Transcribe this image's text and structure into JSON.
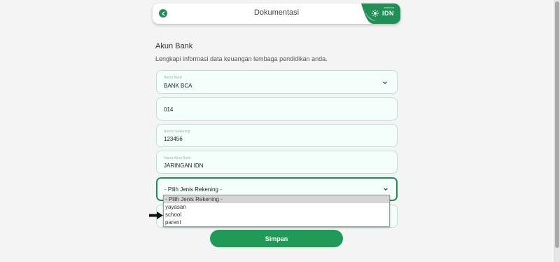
{
  "header": {
    "title": "Dokumentasi",
    "brand_text": "IDN",
    "brand_small": "JARINGAN",
    "brand_color": "#1f8f55"
  },
  "section": {
    "title": "Akun Bank",
    "description": "Lengkapi informasi data keuangan lembaga pendidikan anda."
  },
  "fields": {
    "bank_name": {
      "label": "Nama Bank",
      "value": "BANK BCA"
    },
    "bank_code": {
      "value": "014"
    },
    "account_number": {
      "label": "Nomor Rekening",
      "value": "123456"
    },
    "account_name": {
      "label": "Nama Akun Bank",
      "value": "JARINGAN IDN"
    },
    "account_type": {
      "value": "- Pilih Jenis Rekening -"
    }
  },
  "account_type_options": [
    "- Pilih Jenis Rekening -",
    "yayasan",
    "school",
    "parent"
  ],
  "actions": {
    "save_label": "Simpan"
  },
  "colors": {
    "accent": "#1f9a57",
    "field_bg": "#f4fffb",
    "field_border": "#bde3d0"
  }
}
